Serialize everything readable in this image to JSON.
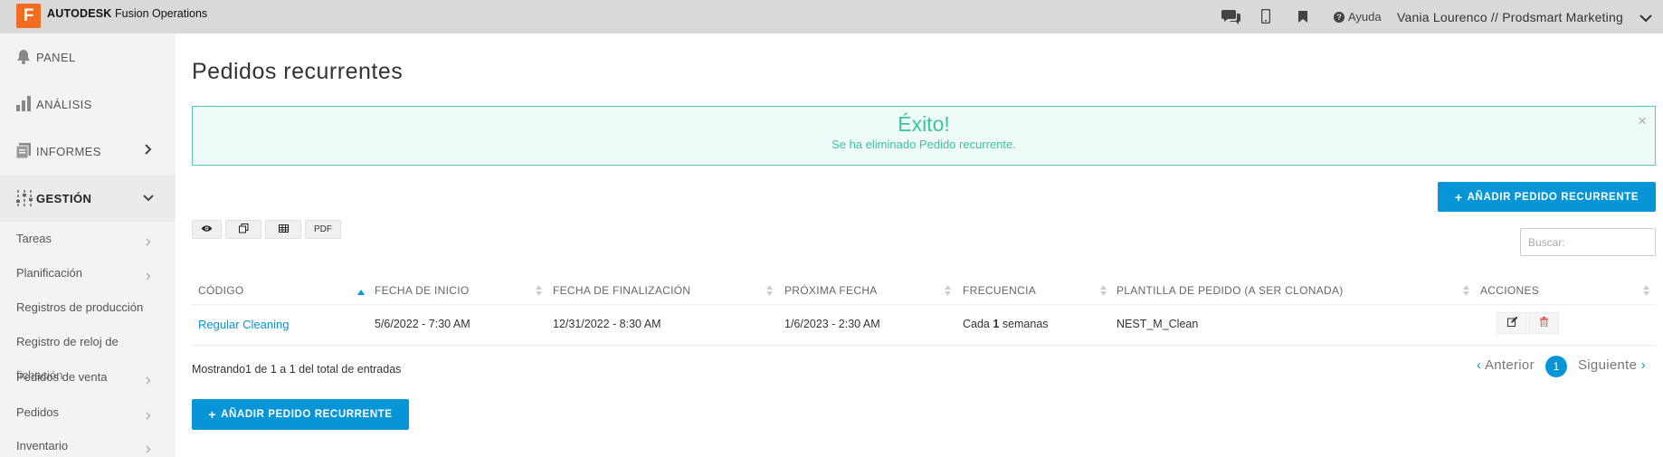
{
  "topbar": {
    "logo_letter": "F",
    "brand_bold": "AUTODESK",
    "brand_rest": "Fusion Operations",
    "help_label": "Ayuda",
    "user_label": "Vania Lourenco // Prodsmart Marketing",
    "icons": [
      "chat-icon",
      "mobile-icon",
      "bookmark-icon",
      "help-icon",
      "chevron-down-icon"
    ]
  },
  "sidebar": {
    "main": [
      {
        "label": "PANEL",
        "icon": "bell-icon"
      },
      {
        "label": "ANÁLISIS",
        "icon": "bar-chart-icon"
      },
      {
        "label": "INFORMES",
        "icon": "report-icon"
      },
      {
        "label": "GESTIÓN",
        "icon": "sliders-icon"
      }
    ],
    "sub": [
      {
        "label": "Tareas"
      },
      {
        "label": "Planificación"
      },
      {
        "label": "Registros de producción"
      },
      {
        "label": "Registro de reloj de"
      },
      {
        "label": "Pedidos de venta",
        "overlap": "fichación"
      },
      {
        "label": "Pedidos"
      },
      {
        "label": "Inventario"
      }
    ]
  },
  "main": {
    "title": "Pedidos recurrentes",
    "alert": {
      "title": "Éxito!",
      "message": "Se ha eliminado Pedido recurrente.",
      "close": "×"
    },
    "add_button": "AÑADIR PEDIDO RECURRENTE",
    "tools": [
      "PDF"
    ],
    "search_placeholder": "Buscar:",
    "table": {
      "headers": [
        "CÓDIGO",
        "FECHA DE INICIO",
        "FECHA DE FINALIZACIÓN",
        "PRÓXIMA FECHA",
        "FRECUENCIA",
        "PLANTILLA DE PEDIDO (A SER CLONADA)",
        "ACCIONES"
      ],
      "rows": [
        {
          "code": "Regular Cleaning",
          "start": "5/6/2022 - 7:30 AM",
          "end": "12/31/2022 - 8:30 AM",
          "next": "1/6/2023 - 2:30 AM",
          "freq_prefix": "Cada",
          "freq_num": "1",
          "freq_suffix": "semanas",
          "template": "NEST_M_Clean"
        }
      ]
    },
    "showing": "Mostrando1 de 1 a 1 del total de entradas",
    "pager": {
      "prev": "Anterior",
      "current": "1",
      "next": "Siguiente"
    }
  },
  "colors": {
    "accent": "#0696d7",
    "success": "#3cc4a2",
    "brand": "#f26d21",
    "delete": "#e05555"
  }
}
